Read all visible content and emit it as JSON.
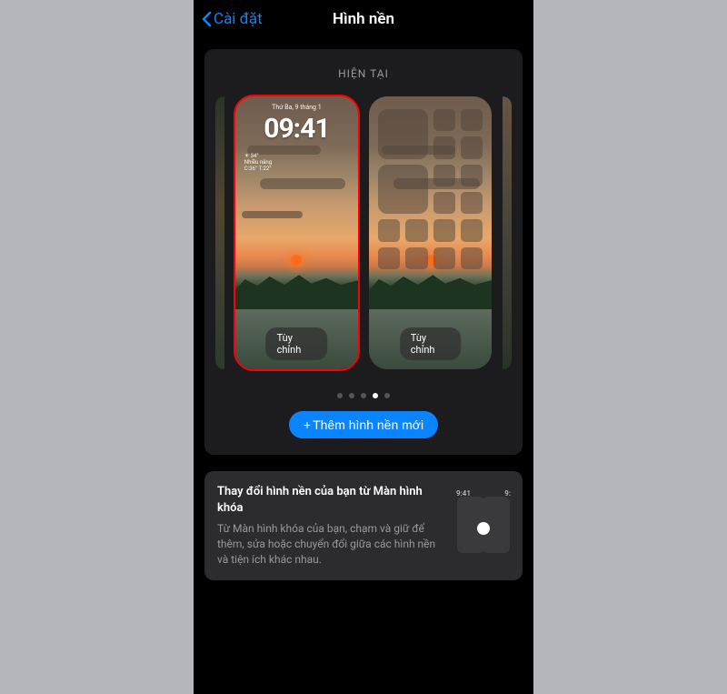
{
  "header": {
    "back_label": "Cài đặt",
    "title": "Hình nền"
  },
  "current": {
    "section_label": "HIỆN TẠI",
    "lock_date": "Thứ Ba, 9 tháng 1",
    "lock_time": "09:41",
    "widget_temp": "☀ 34°",
    "widget_cond": "Nhiều nắng",
    "widget_range": "C:36° T:22°",
    "customize_label": "Tùy chỉnh",
    "add_button_label": "Thêm hình nền mới",
    "pager": {
      "count": 5,
      "active_index": 3
    }
  },
  "tip": {
    "title": "Thay đổi hình nền của bạn từ Màn hình khóa",
    "desc": "Từ Màn hình khóa của bạn, chạm và giữ để thêm, sửa hoặc chuyển đổi giữa các hình nền và tiện ích khác nhau.",
    "mini_time_left": "9:41",
    "mini_time_right": "9:"
  }
}
